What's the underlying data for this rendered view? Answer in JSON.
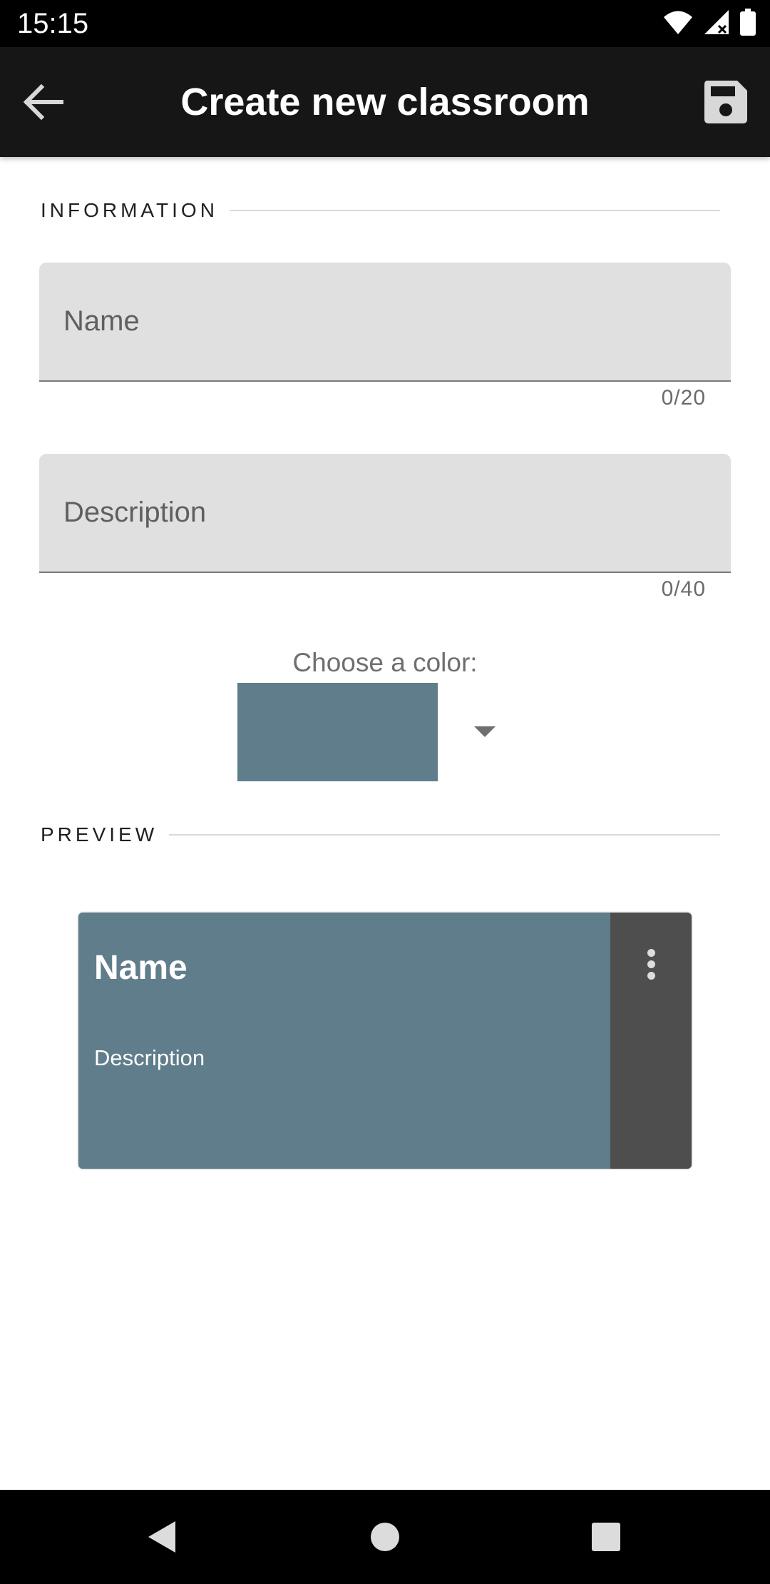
{
  "status_bar": {
    "time": "15:15",
    "icons": [
      "wifi-icon",
      "signal-icon",
      "battery-icon"
    ]
  },
  "app_bar": {
    "title": "Create new classroom",
    "back_icon": "arrow-back-icon",
    "save_icon": "save-icon"
  },
  "information": {
    "section_label": "INFORMATION",
    "name_field": {
      "placeholder": "Name",
      "value": "",
      "counter": "0/20"
    },
    "description_field": {
      "placeholder": "Description",
      "value": "",
      "counter": "0/40"
    },
    "color_label": "Choose a color:",
    "selected_color": "#607d8b"
  },
  "preview": {
    "section_label": "PREVIEW",
    "card": {
      "title": "Name",
      "description": "Description",
      "color": "#607d8b",
      "menu_strip_color": "#4e4e4e",
      "menu_icon": "more-vert-icon"
    }
  },
  "nav_bar": {
    "icons": [
      "back-triangle-icon",
      "home-circle-icon",
      "recents-square-icon"
    ]
  }
}
